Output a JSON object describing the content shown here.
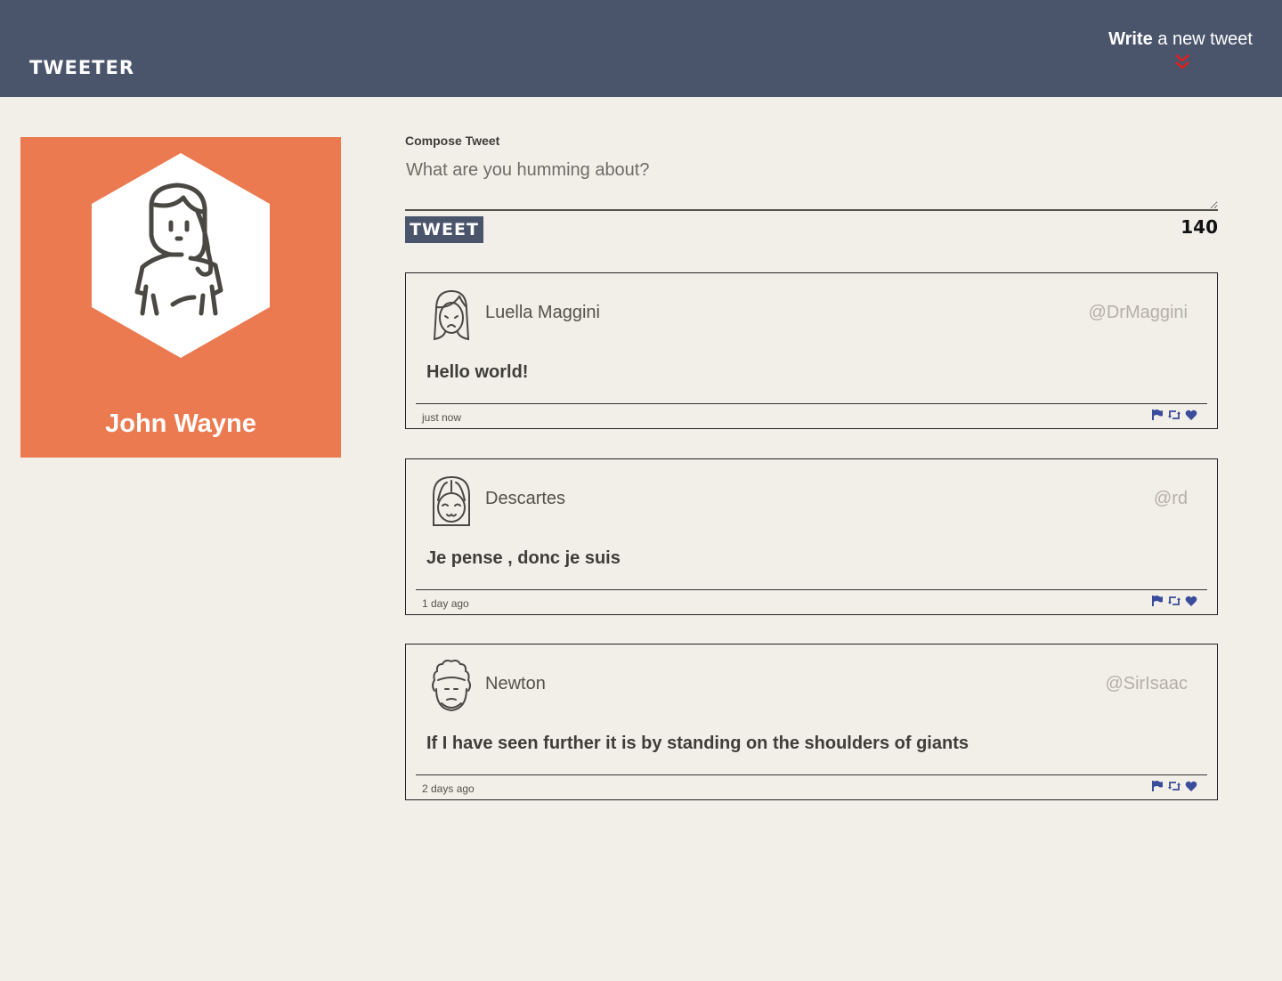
{
  "nav": {
    "brand": "TWEETER",
    "write_strong": "Write",
    "write_rest": " a new tweet",
    "chevron_icon": "double-chevron-down-icon",
    "chevron_color": "#e02020"
  },
  "profile": {
    "name": "John Wayne",
    "background": "#eb7a50",
    "avatar_icon": "user-avatar-icon"
  },
  "compose": {
    "label": "Compose Tweet",
    "placeholder": "What are you humming about?",
    "button_label": "TWEET",
    "counter": "140"
  },
  "tweets": [
    {
      "name": "Luella Maggini",
      "handle": "@DrMaggini",
      "text": "Hello world!",
      "time": "just now"
    },
    {
      "name": "Descartes",
      "handle": "@rd",
      "text": "Je pense , donc je suis",
      "time": "1 day ago"
    },
    {
      "name": "Newton",
      "handle": "@SirIsaac",
      "text": "If I have seen further it is by standing on the shoulders of giants",
      "time": "2 days ago"
    }
  ],
  "actions": [
    "flag-icon",
    "retweet-icon",
    "heart-icon"
  ],
  "colors": {
    "nav": "#4a556c",
    "background": "#f2efe9",
    "accent_action": "#3a4d9c"
  }
}
